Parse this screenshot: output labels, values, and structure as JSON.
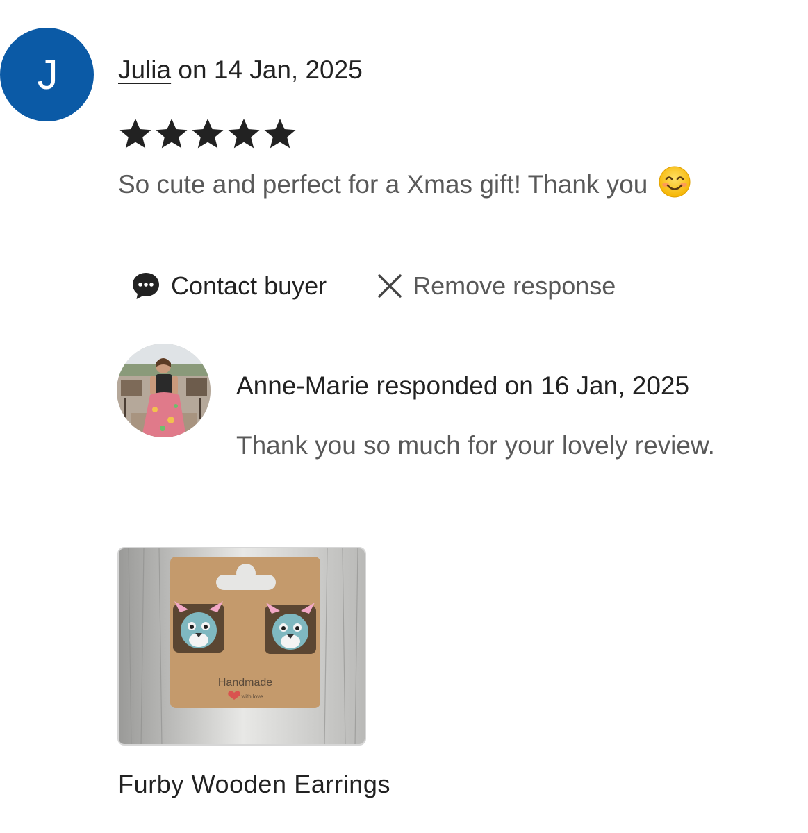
{
  "review": {
    "avatar_initial": "J",
    "avatar_color": "#0b5aa6",
    "reviewer_name": "Julia",
    "date_text": " on 14 Jan, 2025",
    "rating": 5,
    "rating_max": 5,
    "text": "So cute and perfect for a Xmas gift! Thank you",
    "emoji": "smiling-face-emoji"
  },
  "actions": {
    "contact_label": "Contact buyer",
    "contact_icon": "chat-bubble-icon",
    "remove_label": "Remove response",
    "remove_icon": "close-icon"
  },
  "response": {
    "header": "Anne-Marie responded on 16 Jan, 2025",
    "text": "Thank you so much for your lovely review."
  },
  "product": {
    "card_text": "Handmade",
    "card_subtext": "with love",
    "title": "Furby Wooden Earrings"
  }
}
